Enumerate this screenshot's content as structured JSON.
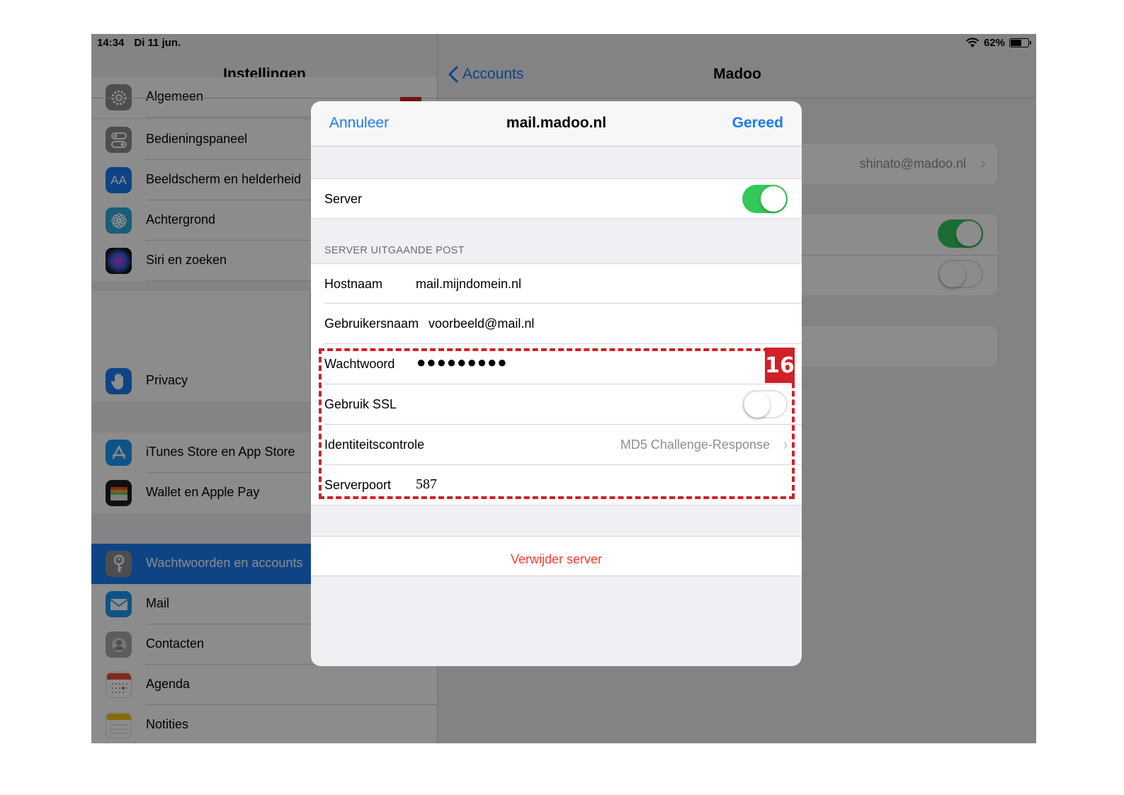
{
  "status": {
    "time": "14:34",
    "date": "Di 11 jun.",
    "battery": "62%"
  },
  "settings": {
    "title": "Instellingen",
    "items": [
      {
        "label": "Algemeen",
        "icon": "gear-icon"
      },
      {
        "label": "Bedieningspaneel",
        "icon": "toggles-icon"
      },
      {
        "label": "Beeldscherm en helderheid",
        "icon": "text-size-icon"
      },
      {
        "label": "Achtergrond",
        "icon": "flower-icon"
      },
      {
        "label": "Siri en zoeken",
        "icon": "siri-icon"
      },
      {
        "label": "Privacy",
        "icon": "hand-icon"
      },
      {
        "label": "iTunes Store en App Store",
        "icon": "app-store-icon"
      },
      {
        "label": "Wallet en Apple Pay",
        "icon": "wallet-icon"
      },
      {
        "label": "Wachtwoorden en accounts",
        "icon": "key-icon",
        "selected": true
      },
      {
        "label": "Mail",
        "icon": "envelope-icon"
      },
      {
        "label": "Contacten",
        "icon": "contacts-icon"
      },
      {
        "label": "Agenda",
        "icon": "calendar-icon"
      },
      {
        "label": "Notities",
        "icon": "notes-icon"
      }
    ]
  },
  "detail": {
    "back_label": "Accounts",
    "title": "Madoo",
    "account_email": "shinato@madoo.nl"
  },
  "sheet": {
    "cancel_label": "Annuleer",
    "title": "mail.madoo.nl",
    "done_label": "Gereed",
    "server_label": "Server",
    "server_enabled": true,
    "section_header": "SERVER UITGAANDE POST",
    "hostname_label": "Hostnaam",
    "hostname_value": "mail.mijndomein.nl",
    "username_label": "Gebruikersnaam",
    "username_value": "voorbeeld@mail.nl",
    "password_label": "Wachtwoord",
    "password_value": "●●●●●●●●●",
    "ssl_label": "Gebruik SSL",
    "ssl_enabled": false,
    "auth_label": "Identiteitscontrole",
    "auth_value": "MD5 Challenge-Response",
    "port_label": "Serverpoort",
    "port_value": "587",
    "delete_label": "Verwijder server"
  },
  "annotation": {
    "step": "16",
    "color": "#d12027"
  },
  "colors": {
    "accent": "#1b7cf0",
    "switch_on": "#34c759",
    "destructive": "#ff3b30"
  }
}
